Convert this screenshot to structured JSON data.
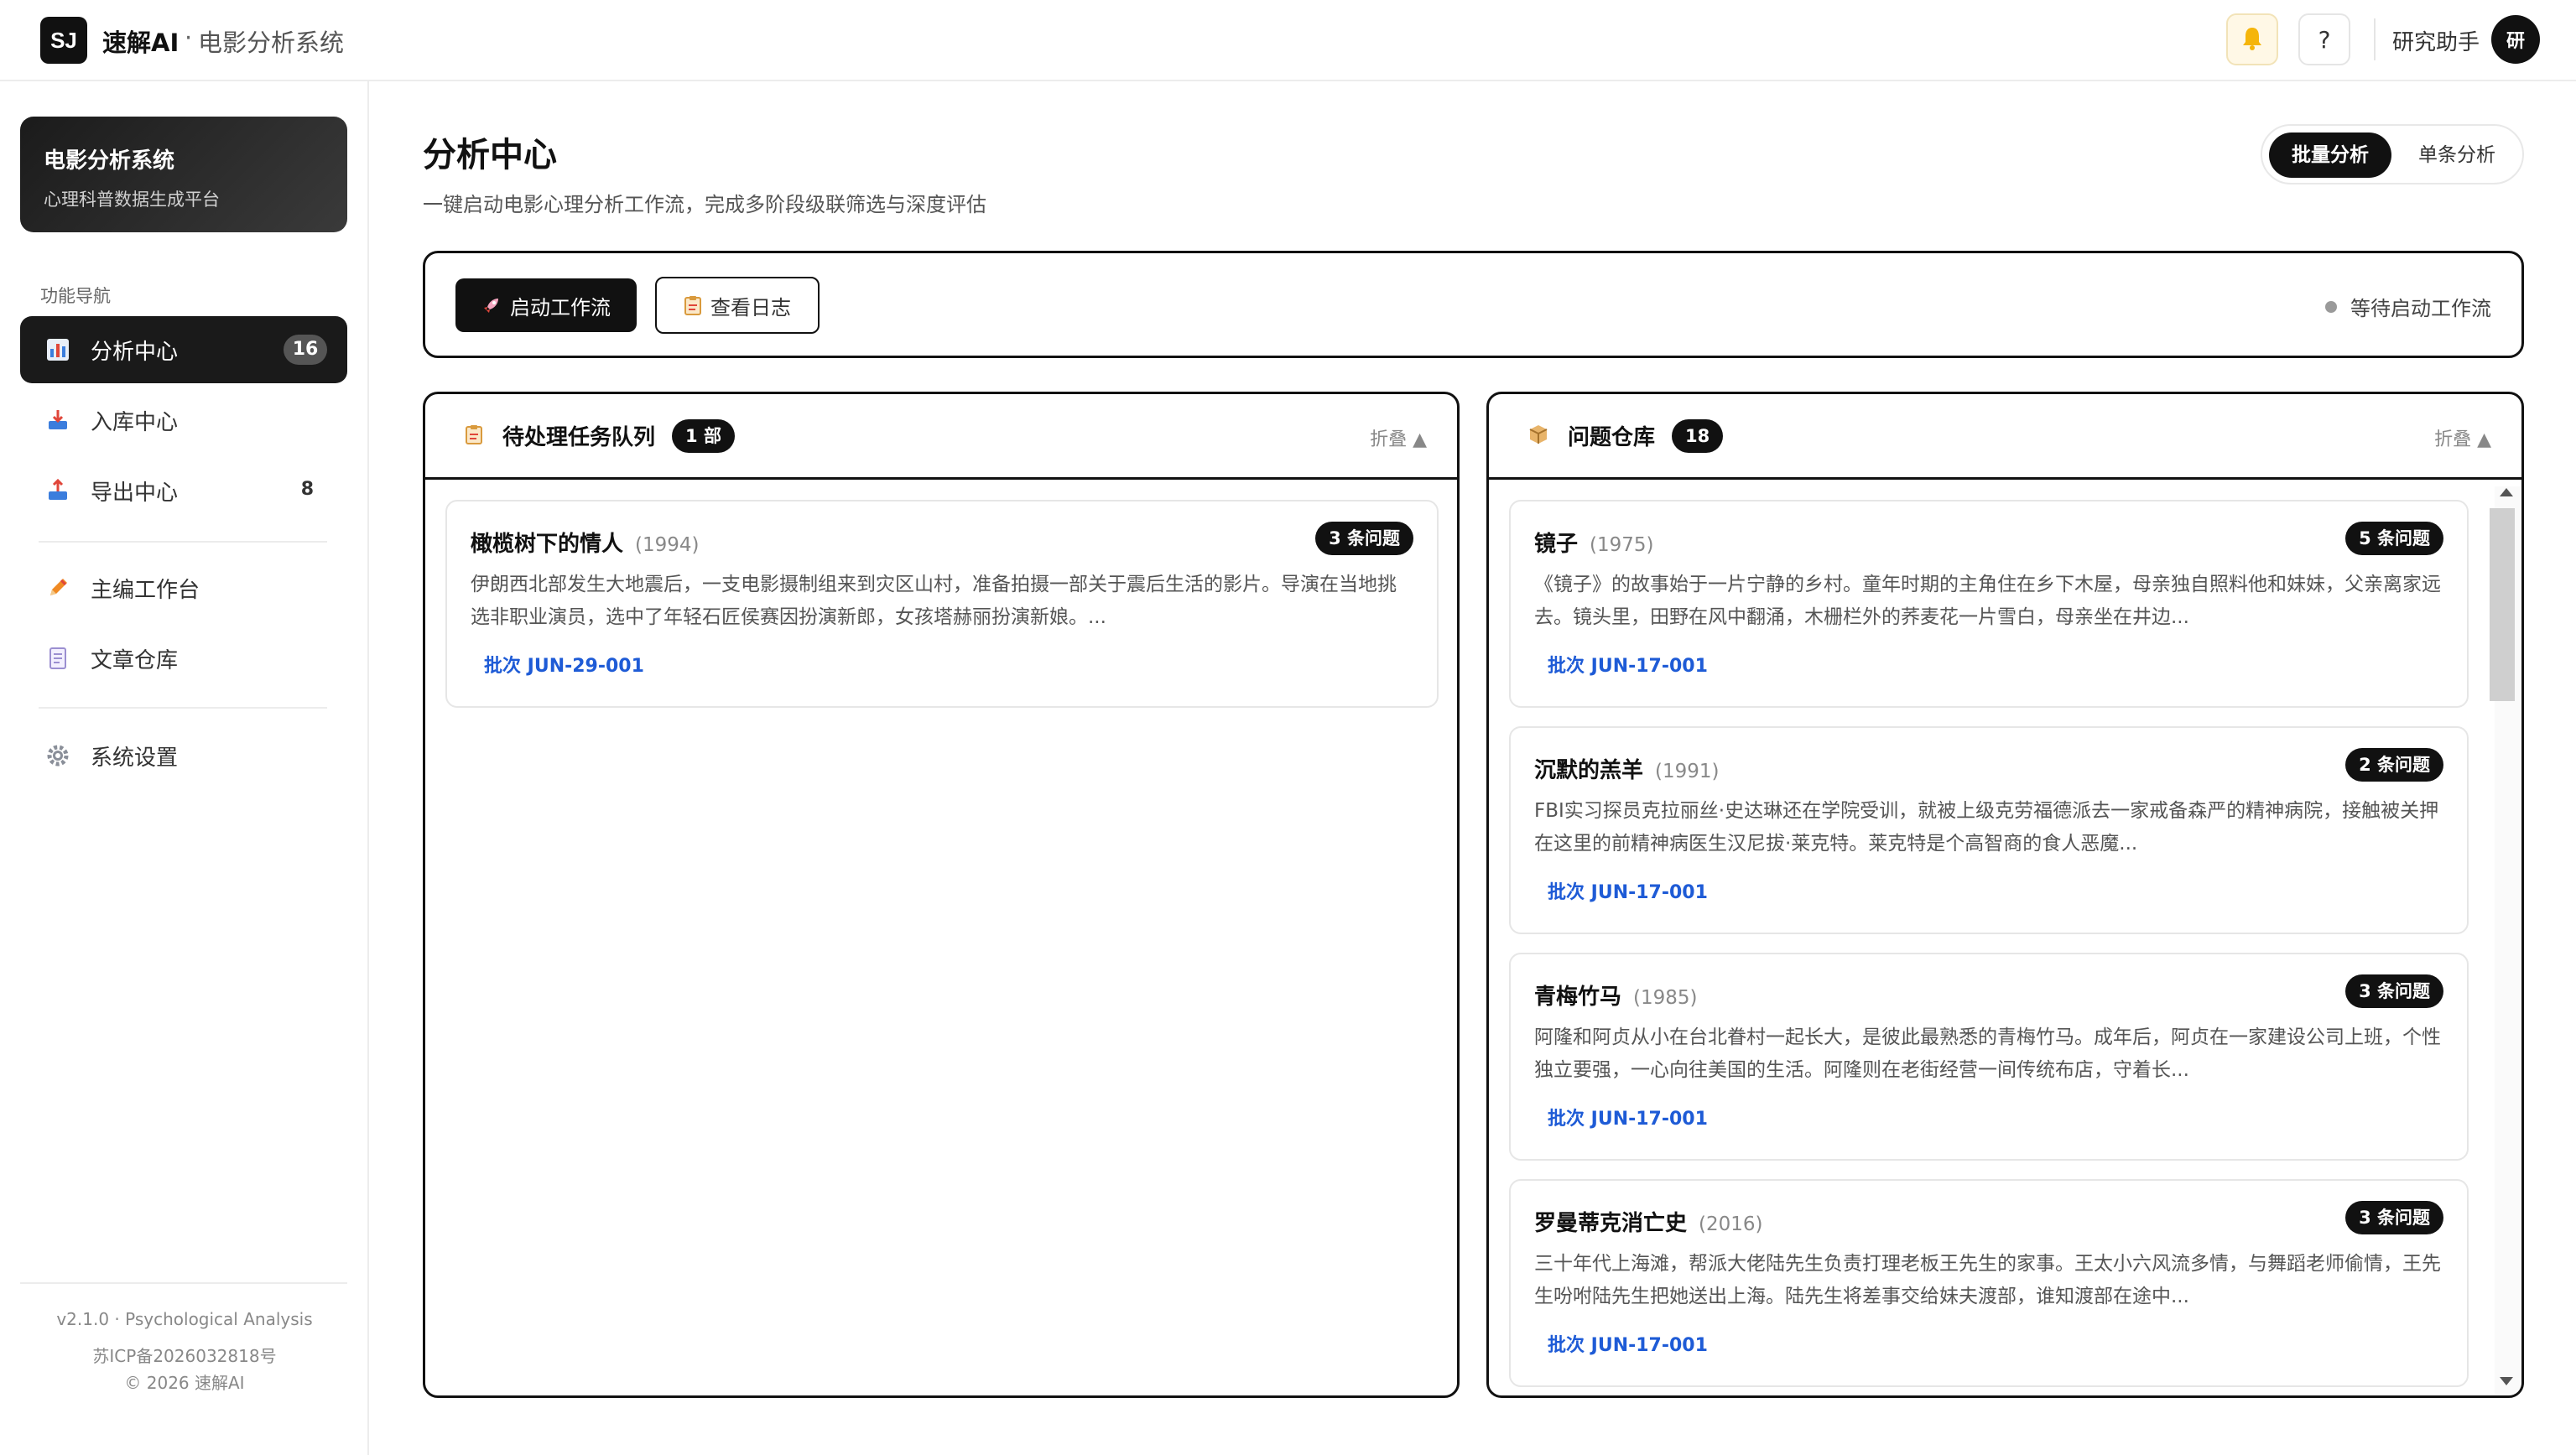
{
  "header": {
    "logo_text": "SJ",
    "brand": "速解AI",
    "separator": "·",
    "subtitle": "电影分析系统",
    "user_name": "研究助手",
    "avatar_text": "研",
    "help_label": "?"
  },
  "sidebar": {
    "card_title": "电影分析系统",
    "card_subtitle": "心理科普数据生成平台",
    "heading": "功能导航",
    "items": [
      {
        "label": "分析中心",
        "badge": "16",
        "icon": "chart-icon",
        "active": true
      },
      {
        "label": "入库中心",
        "icon": "inbox-icon"
      },
      {
        "label": "导出中心",
        "count": "8",
        "icon": "export-icon"
      },
      {
        "label": "主编工作台",
        "icon": "pencil-icon"
      },
      {
        "label": "文章仓库",
        "icon": "document-icon"
      },
      {
        "label": "系统设置",
        "icon": "gear-icon"
      }
    ],
    "footer_version": "v2.1.0 · Psychological Analysis",
    "footer_icp": "苏ICP备2026032818号",
    "footer_copy": "© 2026 速解AI"
  },
  "main": {
    "title": "分析中心",
    "description": "一键启动电影心理分析工作流，完成多阶段级联筛选与深度评估",
    "mode": {
      "batch": "批量分析",
      "single": "单条分析",
      "selected": "批量分析"
    },
    "actions": {
      "start": "启动工作流",
      "log": "查看日志",
      "status": "等待启动工作流"
    }
  },
  "queue": {
    "title": "待处理任务队列",
    "count": "1 部",
    "collapse": "折叠 ▲",
    "items": [
      {
        "title": "橄榄树下的情人",
        "year": "(1994)",
        "questions": "3 条问题",
        "desc": "伊朗西北部发生大地震后，一支电影摄制组来到灾区山村，准备拍摄一部关于震后生活的影片。导演在当地挑选非职业演员，选中了年轻石匠侯赛因扮演新郎，女孩塔赫丽扮演新娘。...",
        "batch": "批次 JUN-29-001"
      }
    ]
  },
  "repo": {
    "title": "问题仓库",
    "count": "18",
    "collapse": "折叠 ▲",
    "items": [
      {
        "title": "镜子",
        "year": "(1975)",
        "questions": "5 条问题",
        "desc": "《镜子》的故事始于一片宁静的乡村。童年时期的主角住在乡下木屋，母亲独自照料他和妹妹，父亲离家远去。镜头里，田野在风中翻涌，木栅栏外的荞麦花一片雪白，母亲坐在井边...",
        "batch": "批次 JUN-17-001"
      },
      {
        "title": "沉默的羔羊",
        "year": "(1991)",
        "questions": "2 条问题",
        "desc": "FBI实习探员克拉丽丝·史达琳还在学院受训，就被上级克劳福德派去一家戒备森严的精神病院，接触被关押在这里的前精神病医生汉尼拔·莱克特。莱克特是个高智商的食人恶魔...",
        "batch": "批次 JUN-17-001"
      },
      {
        "title": "青梅竹马",
        "year": "(1985)",
        "questions": "3 条问题",
        "desc": "阿隆和阿贞从小在台北眷村一起长大，是彼此最熟悉的青梅竹马。成年后，阿贞在一家建设公司上班，个性独立要强，一心向往美国的生活。阿隆则在老街经营一间传统布店，守着长...",
        "batch": "批次 JUN-17-001"
      },
      {
        "title": "罗曼蒂克消亡史",
        "year": "(2016)",
        "questions": "3 条问题",
        "desc": "三十年代上海滩，帮派大佬陆先生负责打理老板王先生的家事。王太小六风流多情，与舞蹈老师偷情，王先生吩咐陆先生把她送出上海。陆先生将差事交给妹夫渡部，谁知渡部在途中...",
        "batch": "批次 JUN-17-001"
      }
    ]
  }
}
